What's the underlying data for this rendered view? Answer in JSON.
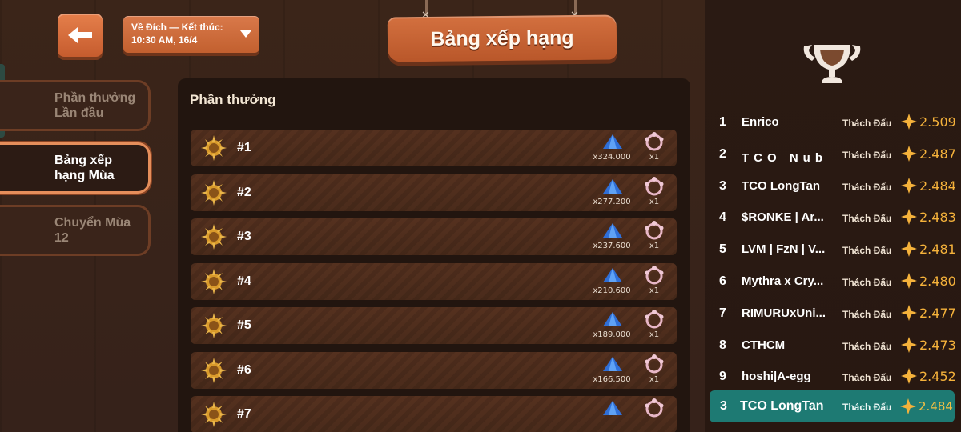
{
  "header": {
    "title": "Bảng xếp hạng",
    "season_line1": "Về Đích — Kết thúc:",
    "season_line2": "10:30 AM, 16/4"
  },
  "tabs": [
    {
      "label_line1": "Phần thưởng",
      "label_line2": "Lần đầu",
      "active": false
    },
    {
      "label_line1": "Bảng xếp",
      "label_line2": "hạng Mùa",
      "active": true
    },
    {
      "label_line1": "Chuyển Mùa",
      "label_line2": "12",
      "active": false
    }
  ],
  "rewards": {
    "title": "Phần thưởng",
    "rows": [
      {
        "rank": "#1",
        "gems": "x324.000",
        "frames": "x1"
      },
      {
        "rank": "#2",
        "gems": "x277.200",
        "frames": "x1"
      },
      {
        "rank": "#3",
        "gems": "x237.600",
        "frames": "x1"
      },
      {
        "rank": "#4",
        "gems": "x210.600",
        "frames": "x1"
      },
      {
        "rank": "#5",
        "gems": "x189.000",
        "frames": "x1"
      },
      {
        "rank": "#6",
        "gems": "x166.500",
        "frames": "x1"
      },
      {
        "rank": "#7",
        "gems": "",
        "frames": ""
      }
    ]
  },
  "leaderboard": {
    "rows": [
      {
        "num": "1",
        "name": "Enrico",
        "tier": "Thách Đấu",
        "points": "2.509"
      },
      {
        "num": "2",
        "name": "TCO Nub",
        "tier": "Thách Đấu",
        "points": "2.487"
      },
      {
        "num": "3",
        "name": "TCO LongTan",
        "tier": "Thách Đấu",
        "points": "2.484"
      },
      {
        "num": "4",
        "name": "$RONKE | Ar...",
        "tier": "Thách Đấu",
        "points": "2.483"
      },
      {
        "num": "5",
        "name": "LVM | FzN | V...",
        "tier": "Thách Đấu",
        "points": "2.481"
      },
      {
        "num": "6",
        "name": "Mythra x Cry...",
        "tier": "Thách Đấu",
        "points": "2.480"
      },
      {
        "num": "7",
        "name": "RIMURUxUni...",
        "tier": "Thách Đấu",
        "points": "2.477"
      },
      {
        "num": "8",
        "name": "CTHCM",
        "tier": "Thách Đấu",
        "points": "2.473"
      },
      {
        "num": "9",
        "name": "hoshi|A-egg",
        "tier": "Thách Đấu",
        "points": "2.452"
      }
    ],
    "me": {
      "num": "3",
      "name": "TCO LongTan",
      "tier": "Thách Đấu",
      "points": "2.484"
    }
  },
  "icons": {
    "back": "back-arrow-icon",
    "dropdown": "chevron-down-icon",
    "trophy": "trophy-icon",
    "emblem": "rank-emblem-icon",
    "gem": "blue-gem-icon",
    "frame": "avatar-frame-icon",
    "star": "star-icon"
  },
  "colors": {
    "accent_orange": "#d3703f",
    "points_gold": "#f5b23b",
    "me_row_teal": "#1e7a73"
  }
}
